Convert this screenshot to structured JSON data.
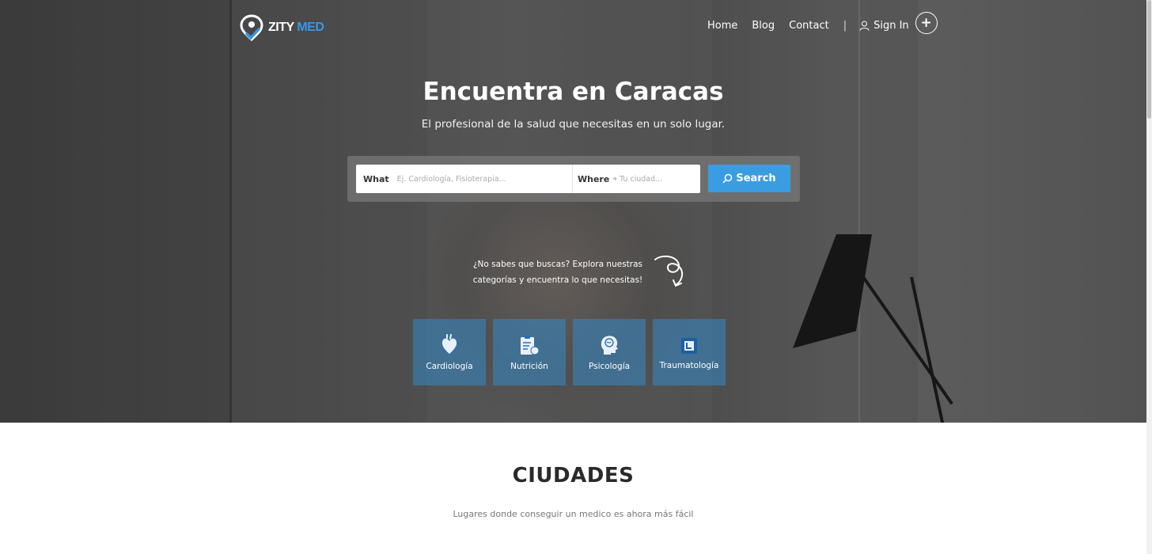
{
  "brand": {
    "name": "ZITY",
    "accent": "MED",
    "accent_color": "#3a96e0"
  },
  "nav": {
    "links": [
      "Home",
      "Blog",
      "Contact"
    ],
    "separator": "|",
    "signin": "Sign In",
    "add": "+"
  },
  "hero": {
    "title": "Encuentra en Caracas",
    "subtitle": "El profesional de la salud que necesitas en un solo lugar."
  },
  "search": {
    "what_label": "What",
    "what_placeholder": "Ej. Cardiología, Fisioterapia...",
    "where_label": "Where",
    "where_placeholder": "Tu ciudad...",
    "button": "Search",
    "button_color": "#3a9de2"
  },
  "explore": {
    "line1": "¿No sabes que buscas? Explora nuestras",
    "line2": "categorías y encuentra lo que necesitas!"
  },
  "categories": [
    {
      "label": "Cardiología",
      "icon": "heart-icon"
    },
    {
      "label": "Nutrición",
      "icon": "clipboard-apple-icon"
    },
    {
      "label": "Psicología",
      "icon": "head-brain-icon"
    },
    {
      "label": "Traumatología",
      "icon": "xray-icon"
    }
  ],
  "cities": {
    "title": "CIUDADES",
    "subtitle": "Lugares donde conseguir un medico es ahora más fácil"
  }
}
